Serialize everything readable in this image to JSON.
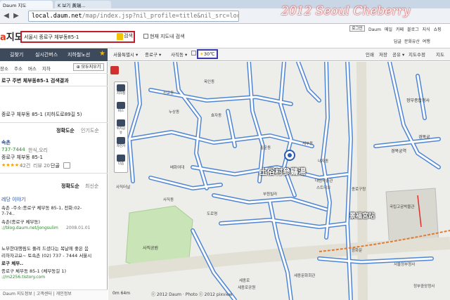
{
  "browser": {
    "tab1": "Daum 지도",
    "tab2": "K 보기 黃瑞...",
    "url_host": "local.daum.net",
    "url_rest": "/map/index.jsp?nil_profile=title&nil_src=local"
  },
  "watermark": "2012 Seoul Cheberry",
  "header": {
    "logo_mark": "a",
    "logo_text": "지도",
    "search_value": "서울시 종로구 체부동85-1",
    "search_button": "검색",
    "current_map_search": "현재 지도내 검색",
    "login": "로그인",
    "links": [
      "Daum",
      "메일",
      "카페",
      "블로그",
      "지식",
      "쇼핑"
    ],
    "links2": [
      "문화유산",
      "여행"
    ],
    "links2_prefix": "답글"
  },
  "nav": {
    "tabs": [
      "길찾기",
      "실시간버스",
      "지하철노선"
    ],
    "map_controls": [
      "서울특별시 ▾",
      "종로구 ▾",
      "사직동 ▾"
    ],
    "temperature": "30℃",
    "right_controls": [
      "인쇄",
      "저장",
      "공유 ▾",
      "지도수정",
      "지도"
    ]
  },
  "left": {
    "subtabs": [
      "장소",
      "주소",
      "버스",
      "지하"
    ],
    "route_button": "⊕ 모두지우기",
    "result_title": "로구 주변 체부동85-1 검색결과",
    "result_address": "종로구 체부동 85-1 (지하도로89길 5)",
    "sort1_active": "정확도순",
    "sort1_other": "인기도순",
    "place_name": "속촌",
    "place_phone": "737-7444",
    "place_category": "한식,오리",
    "place_addr": "종로구 체부동 85-1",
    "place_rating": "42건",
    "place_reviews": "리뷰 20",
    "place_badge": "단골",
    "sort2_active": "정확도순",
    "sort2_other": "최신순",
    "blog_title": "레당 이야기",
    "blog_line1": "속촌 -주소:종로구 체부동 85-1, 전화:02-",
    "blog_line2": "7-74..",
    "blog_line3": "속촌(종로구 체부동)",
    "blog_url": "://blog.daum.net/jongsulim",
    "blog_date": "2008.01.01",
    "blog2_line1": "뇨부한대행림도 풀려 드셨다는 복날에 좋은 음",
    "blog2_line2": "리하자고요~ 토속촌 (02) 737 - 7444 서울시",
    "blog2_line3": "로구 체부..",
    "blog2_addr": "종로구 체부동 85-1 (체부동길 1)",
    "blog2_url": "://m2256.tistory.com",
    "footer": "Daum 지도정보  |  고객센터  |  개인정보"
  },
  "map": {
    "tools": [
      "지하철",
      "버스",
      "위치공유",
      "자전거",
      "다음"
    ],
    "labels": {
      "poi_main": "土俗村參鷄湯",
      "poi_palace": "景福宮站",
      "l1": "정부종합청사",
      "l2": "경복궁역",
      "l3": "누상동",
      "l4": "옥인동",
      "l5": "체부동",
      "l6": "필운동",
      "l7": "내자동",
      "l8": "사직동",
      "l9": "사직공원",
      "l10": "세종로",
      "l11": "부원빌라",
      "l12": "스트디오",
      "l13": "대림미술관",
      "l14": "배화여대",
      "l15": "종로구청",
      "l16": "도로명",
      "l17": "세종문화회관",
      "l18": "광화문",
      "l19": "정부중앙청사",
      "l20": "경복궁",
      "l21": "국립고궁박물관",
      "l22": "서울정부청사",
      "l23": "세종로공원",
      "l24": "사직터널",
      "l25": "효자동",
      "l26": "신교동"
    },
    "scale": "0m     64m",
    "copyright": "ⓒ 2012 Daum · Photo ⓒ 2012 pixview"
  },
  "colors": {
    "road_blue": "#4f86d4",
    "road_fill": "#ffffff",
    "park_green": "#c9e4b6",
    "block_fill": "#ededea",
    "big_road": "#e2e0d4"
  }
}
